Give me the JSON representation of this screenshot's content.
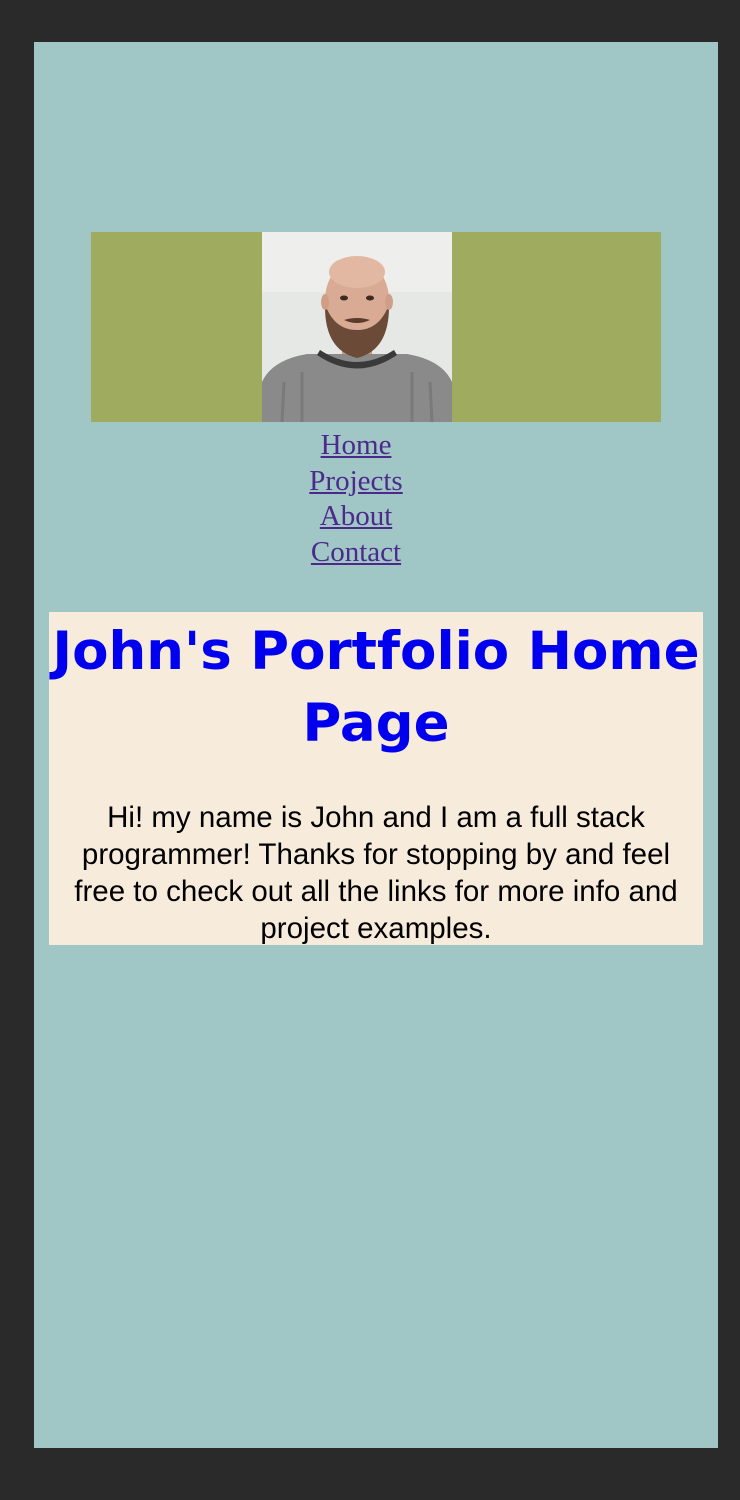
{
  "colors": {
    "frame": "#2a2a2a",
    "page_background": "#a1c6c6",
    "banner_background": "#9fab5f",
    "content_background": "#f7ebdc",
    "heading": "#0000ee",
    "nav_link": "#4b2a8c"
  },
  "banner": {
    "photo_icon": "profile-photo"
  },
  "nav": {
    "links": [
      {
        "label": "Home"
      },
      {
        "label": "Projects"
      },
      {
        "label": "About"
      },
      {
        "label": "Contact"
      }
    ]
  },
  "content": {
    "heading": "John's Portfolio Home Page",
    "intro": "Hi! my name is John and I am a full stack programmer! Thanks for stopping by and feel free to check out all the links for more info and project examples."
  }
}
